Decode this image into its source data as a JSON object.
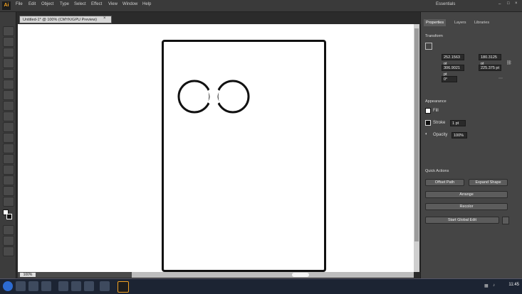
{
  "menubar": {
    "app_logo": "Ai",
    "items": [
      "File",
      "Edit",
      "Object",
      "Type",
      "Select",
      "Effect",
      "View",
      "Window",
      "Help"
    ],
    "workspace": "Essentials"
  },
  "document": {
    "tab_title": "Untitled-1* @ 100% (CMYK/GPU Preview)",
    "close_glyph": "×"
  },
  "status": {
    "zoom": "100%"
  },
  "panel": {
    "tabs": [
      "Properties",
      "Layers",
      "Libraries"
    ],
    "section_transform": "Transform",
    "x_value": "252.1563 pt",
    "y_value": "306.9021 pt",
    "w_value": "180.3125 pt",
    "h_value": "225.375 pt",
    "angle_value": "0°",
    "section_appearance": "Appearance",
    "fill_label": "Fill",
    "stroke_label": "Stroke",
    "stroke_value": "1 pt",
    "opacity_label": "Opacity",
    "opacity_value": "100%",
    "section_quick": "Quick Actions",
    "btn_offset": "Offset Path",
    "btn_expand": "Expand Shape",
    "btn_arrange": "Arrange",
    "btn_recolor": "Recolor",
    "btn_global_edit": "Start Global Edit"
  },
  "colors": {
    "fill": "#ffffff",
    "stroke": "#111111",
    "accent": "#f0a020"
  },
  "taskbar": {
    "clock": "11:45"
  }
}
